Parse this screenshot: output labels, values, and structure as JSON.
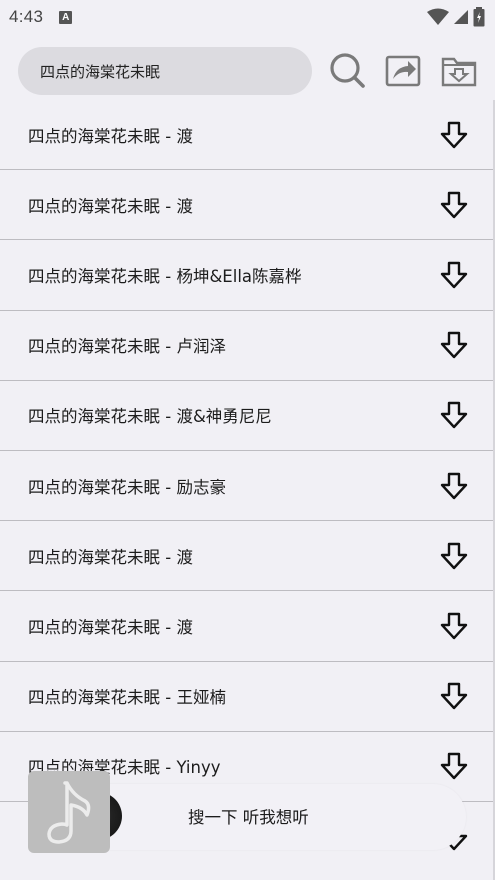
{
  "status": {
    "time": "4:43",
    "notification_icon": "a-icon",
    "icons": [
      "wifi-icon",
      "signal-icon",
      "battery-icon"
    ]
  },
  "header": {
    "search_value": "四点的海棠花未眠",
    "icons": [
      "search-icon",
      "share-icon",
      "download-folder-icon"
    ]
  },
  "results": [
    {
      "title": "四点的海棠花未眠 - 渡"
    },
    {
      "title": "四点的海棠花未眠 - 渡"
    },
    {
      "title": "四点的海棠花未眠 - 杨坤&Ella陈嘉桦"
    },
    {
      "title": "四点的海棠花未眠 - 卢润泽"
    },
    {
      "title": "四点的海棠花未眠 - 渡&神勇尼尼"
    },
    {
      "title": "四点的海棠花未眠 - 励志豪"
    },
    {
      "title": "四点的海棠花未眠 - 渡"
    },
    {
      "title": "四点的海棠花未眠 - 渡"
    },
    {
      "title": "四点的海棠花未眠 - 王娅楠"
    },
    {
      "title": "四点的海棠花未眠 - Yinyy"
    }
  ],
  "player": {
    "prompt": "搜一下 听我想听",
    "cover_icon": "music-note-icon"
  }
}
